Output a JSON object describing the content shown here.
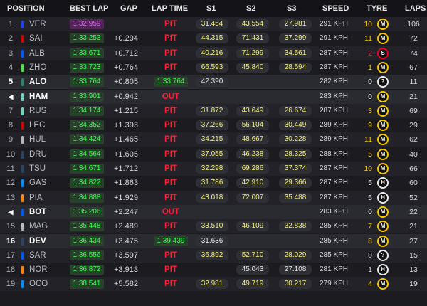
{
  "header": {
    "position": "POSITION",
    "best_lap": "BEST LAP",
    "gap": "GAP",
    "lap_time": "LAP TIME",
    "s1": "S1",
    "s2": "S2",
    "s3": "S3",
    "speed": "SPEED",
    "tyre": "TYRE",
    "laps": "LAPS"
  },
  "colors": {
    "purple_best": "#e35cff",
    "green_best": "#39ff4f",
    "pit_red": "#ff1f35",
    "sector_yellow": "#f5f07a",
    "medium_tyre": "#f5c700",
    "soft_tyre": "#e8002d",
    "hard_tyre": "#e9e9e9"
  },
  "rows": [
    {
      "pos": "1",
      "team_color": "#1e41ff",
      "driver": "VER",
      "best_lap": "1:32.959",
      "best_purple": true,
      "gap": "",
      "lap_time": "PIT",
      "s1": "31.454",
      "s2": "43.554",
      "s3": "27.981",
      "speed": "291 KPH",
      "tyre_age": "10",
      "tyre_age_color": "yellow",
      "tyre": "M",
      "laps": "106"
    },
    {
      "pos": "2",
      "team_color": "#dc0000",
      "driver": "SAI",
      "best_lap": "1:33.253",
      "best_purple": false,
      "gap": "+0.294",
      "lap_time": "PIT",
      "s1": "44.315",
      "s2": "71.431",
      "s3": "37.299",
      "speed": "291 KPH",
      "tyre_age": "11",
      "tyre_age_color": "yellow",
      "tyre": "M",
      "laps": "72"
    },
    {
      "pos": "3",
      "team_color": "#005aff",
      "driver": "ALB",
      "best_lap": "1:33.671",
      "best_purple": false,
      "gap": "+0.712",
      "lap_time": "PIT",
      "s1": "40.216",
      "s2": "71.299",
      "s3": "34.561",
      "speed": "287 KPH",
      "tyre_age": "2",
      "tyre_age_color": "red",
      "tyre": "S",
      "laps": "74"
    },
    {
      "pos": "4",
      "team_color": "#52e252",
      "driver": "ZHO",
      "best_lap": "1:33.723",
      "best_purple": false,
      "gap": "+0.764",
      "lap_time": "PIT",
      "s1": "66.593",
      "s2": "45.840",
      "s3": "28.594",
      "speed": "287 KPH",
      "tyre_age": "1",
      "tyre_age_color": "yellow",
      "tyre": "M",
      "laps": "67"
    },
    {
      "pos": "5",
      "team_color": "#2d826d",
      "driver": "ALO",
      "best_lap": "1:33.764",
      "best_purple": false,
      "gap": "+0.805",
      "lap_time_box": "1:33.764",
      "s1": "42.390",
      "s1_white": true,
      "s2": "",
      "s3": "",
      "speed": "282 KPH",
      "tyre_age": "0",
      "tyre_age_color": "white",
      "tyre": "?",
      "laps": "11",
      "focus": true
    },
    {
      "pos": "◀",
      "pos_red": true,
      "team_color": "#6cd3bf",
      "driver": "HAM",
      "best_lap": "1:33.901",
      "best_purple": false,
      "gap": "+0.942",
      "lap_time": "OUT",
      "s1": "",
      "s2": "",
      "s3": "",
      "speed": "283 KPH",
      "tyre_age": "0",
      "tyre_age_color": "white",
      "tyre": "M",
      "laps": "21",
      "focus": true
    },
    {
      "pos": "7",
      "team_color": "#6cd3bf",
      "driver": "RUS",
      "best_lap": "1:34.174",
      "best_purple": false,
      "gap": "+1.215",
      "lap_time": "PIT",
      "s1": "31.872",
      "s2": "43.649",
      "s3": "26.674",
      "speed": "287 KPH",
      "tyre_age": "3",
      "tyre_age_color": "yellow",
      "tyre": "M",
      "laps": "69"
    },
    {
      "pos": "8",
      "team_color": "#dc0000",
      "driver": "LEC",
      "best_lap": "1:34.352",
      "best_purple": false,
      "gap": "+1.393",
      "lap_time": "PIT",
      "s1": "37.266",
      "s2": "56.104",
      "s3": "30.449",
      "speed": "289 KPH",
      "tyre_age": "9",
      "tyre_age_color": "yellow",
      "tyre": "M",
      "laps": "29"
    },
    {
      "pos": "9",
      "team_color": "#b6babd",
      "driver": "HUL",
      "best_lap": "1:34.424",
      "best_purple": false,
      "gap": "+1.465",
      "lap_time": "PIT",
      "s1": "34.215",
      "s2": "48.667",
      "s3": "30.228",
      "speed": "289 KPH",
      "tyre_age": "11",
      "tyre_age_color": "yellow",
      "tyre": "M",
      "laps": "62"
    },
    {
      "pos": "10",
      "team_color": "#2b4562",
      "driver": "DRU",
      "best_lap": "1:34.564",
      "best_purple": false,
      "gap": "+1.605",
      "lap_time": "PIT",
      "s1": "37.055",
      "s2": "46.238",
      "s3": "28.325",
      "speme": "",
      "speed": "288 KPH",
      "tyre_age": "5",
      "tyre_age_color": "yellow",
      "tyre": "M",
      "laps": "40"
    },
    {
      "pos": "11",
      "team_color": "#2b4562",
      "driver": "TSU",
      "best_lap": "1:34.671",
      "best_purple": false,
      "gap": "+1.712",
      "lap_time": "PIT",
      "s1": "32.298",
      "s2": "69.286",
      "s3": "37.374",
      "speed": "287 KPH",
      "tyre_age": "10",
      "tyre_age_color": "yellow",
      "tyre": "M",
      "laps": "66"
    },
    {
      "pos": "12",
      "team_color": "#0090ff",
      "driver": "GAS",
      "best_lap": "1:34.822",
      "best_purple": false,
      "gap": "+1.863",
      "lap_time": "PIT",
      "s1": "31.786",
      "s2": "42.910",
      "s3": "29.366",
      "speed": "287 KPH",
      "tyre_age": "5",
      "tyre_age_color": "white",
      "tyre": "H",
      "laps": "60"
    },
    {
      "pos": "13",
      "team_color": "#ff8700",
      "driver": "PIA",
      "best_lap": "1:34.888",
      "best_purple": false,
      "gap": "+1.929",
      "lap_time": "PIT",
      "s1": "43.018",
      "s2": "72.007",
      "s3": "35.488",
      "speed": "287 KPH",
      "tyre_age": "5",
      "tyre_age_color": "white",
      "tyre": "H",
      "laps": "52"
    },
    {
      "pos": "◀",
      "pos_red": true,
      "team_color": "#005aff",
      "driver": "BOT",
      "best_lap": "1:35.206",
      "best_purple": false,
      "gap": "+2.247",
      "lap_time": "OUT",
      "s1": "",
      "s2": "",
      "s3": "",
      "speed": "283 KPH",
      "tyre_age": "0",
      "tyre_age_color": "white",
      "tyre": "M",
      "laps": "22",
      "focus": true
    },
    {
      "pos": "15",
      "team_color": "#b6babd",
      "driver": "MAG",
      "best_lap": "1:35.448",
      "best_purple": false,
      "gap": "+2.489",
      "lap_time": "PIT",
      "s1": "33.510",
      "s2": "46.109",
      "s3": "32.838",
      "speed": "285 KPH",
      "tyre_age": "7",
      "tyre_age_color": "yellow",
      "tyre": "M",
      "laps": "21"
    },
    {
      "pos": "16",
      "team_color": "#2b4562",
      "driver": "DEV",
      "best_lap": "1:36.434",
      "best_purple": false,
      "gap": "+3.475",
      "lap_time_box": "1:39.439",
      "s1": "31.636",
      "s1_white": true,
      "s2": "",
      "s3": "",
      "speed": "285 KPH",
      "tyre_age": "8",
      "tyre_age_color": "yellow",
      "tyre": "M",
      "laps": "27",
      "focus": true
    },
    {
      "pos": "17",
      "team_color": "#005aff",
      "driver": "SAR",
      "best_lap": "1:36.556",
      "best_purple": false,
      "gap": "+3.597",
      "lap_time": "PIT",
      "s1": "36.892",
      "s2": "52.710",
      "s3": "28.029",
      "speed": "285 KPH",
      "tyre_age": "0",
      "tyre_age_color": "white",
      "tyre": "?",
      "laps": "15"
    },
    {
      "pos": "18",
      "team_color": "#ff8700",
      "driver": "NOR",
      "best_lap": "1:36.872",
      "best_purple": false,
      "gap": "+3.913",
      "lap_time": "PIT",
      "s1": "",
      "s2": "45.043",
      "s3": "27.108",
      "s2_white": true,
      "s3_white": true,
      "speed": "281 KPH",
      "tyre_age": "1",
      "tyre_age_color": "white",
      "tyre": "H",
      "laps": "13"
    },
    {
      "pos": "19",
      "team_color": "#0090ff",
      "driver": "OCO",
      "best_lap": "1:38.541",
      "best_purple": false,
      "gap": "+5.582",
      "lap_time": "PIT",
      "s1": "32.981",
      "s2": "49.719",
      "s3": "30.217",
      "speed": "279 KPH",
      "tyre_age": "4",
      "tyre_age_color": "yellow",
      "tyre": "M",
      "laps": "19"
    }
  ]
}
